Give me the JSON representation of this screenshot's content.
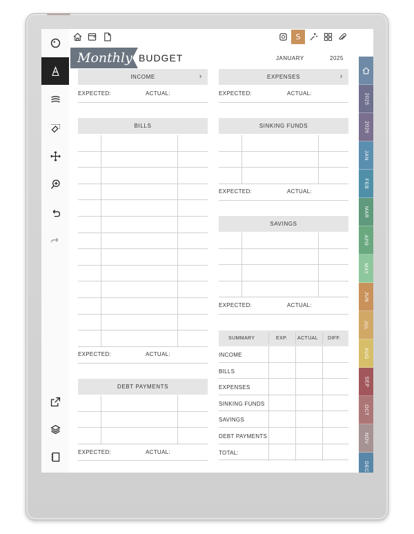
{
  "header": {
    "title_script": "Monthly",
    "title_word": "BUDGET",
    "month": "JANUARY",
    "year": "2025"
  },
  "toolbar": {
    "icons": [
      "menu-circle-icon",
      "pen-icon",
      "strokes-icon",
      "eraser-icon",
      "move-icon",
      "zoom-icon",
      "undo-icon",
      "redo-icon",
      "share-icon",
      "layers-icon",
      "document-icon"
    ]
  },
  "top_icons": [
    "home-icon",
    "tray-icon",
    "page-icon",
    "quick-icon",
    "sketch-icon",
    "magic-icon",
    "layout-icon",
    "attach-icon"
  ],
  "top_active_label": "S",
  "income": {
    "title": "INCOME",
    "expected": "EXPECTED:",
    "actual": "ACTUAL:"
  },
  "expenses": {
    "title": "EXPENSES",
    "expected": "EXPECTED:",
    "actual": "ACTUAL:"
  },
  "bills": {
    "title": "BILLS",
    "expected": "EXPECTED:",
    "actual": "ACTUAL:"
  },
  "sinking": {
    "title": "SINKING FUNDS",
    "expected": "EXPECTED:",
    "actual": "ACTUAL:"
  },
  "savings": {
    "title": "SAVINGS",
    "expected": "EXPECTED:",
    "actual": "ACTUAL:"
  },
  "debt": {
    "title": "DEBT PAYMENTS",
    "expected": "EXPECTED:",
    "actual": "ACTUAL:"
  },
  "summary": {
    "title": "SUMMARY",
    "cols": [
      "EXP.",
      "ACTUAL",
      "DIFF."
    ],
    "rows": [
      "INCOME",
      "BILLS",
      "EXPENSES",
      "SINKING FUNDS",
      "SAVINGS",
      "DEBT PAYMENTS",
      "TOTAL:"
    ]
  },
  "tabs": [
    {
      "label": "home",
      "color": "#6f8aa6"
    },
    {
      "label": "2025",
      "color": "#6f6f8e"
    },
    {
      "label": "2026",
      "color": "#7a6f8e"
    },
    {
      "label": "JAN",
      "color": "#5b8fb0"
    },
    {
      "label": "FEB",
      "color": "#4f90a8"
    },
    {
      "label": "MAR",
      "color": "#5f9a7c"
    },
    {
      "label": "APR",
      "color": "#6aa980"
    },
    {
      "label": "MAY",
      "color": "#8fc79c"
    },
    {
      "label": "JUN",
      "color": "#c9925b"
    },
    {
      "label": "JUL",
      "color": "#d1a865"
    },
    {
      "label": "AUG",
      "color": "#d7bf6a"
    },
    {
      "label": "SEP",
      "color": "#a1575b"
    },
    {
      "label": "OCT",
      "color": "#ad7676"
    },
    {
      "label": "NOV",
      "color": "#a69292"
    },
    {
      "label": "DEC",
      "color": "#5887a9"
    }
  ]
}
